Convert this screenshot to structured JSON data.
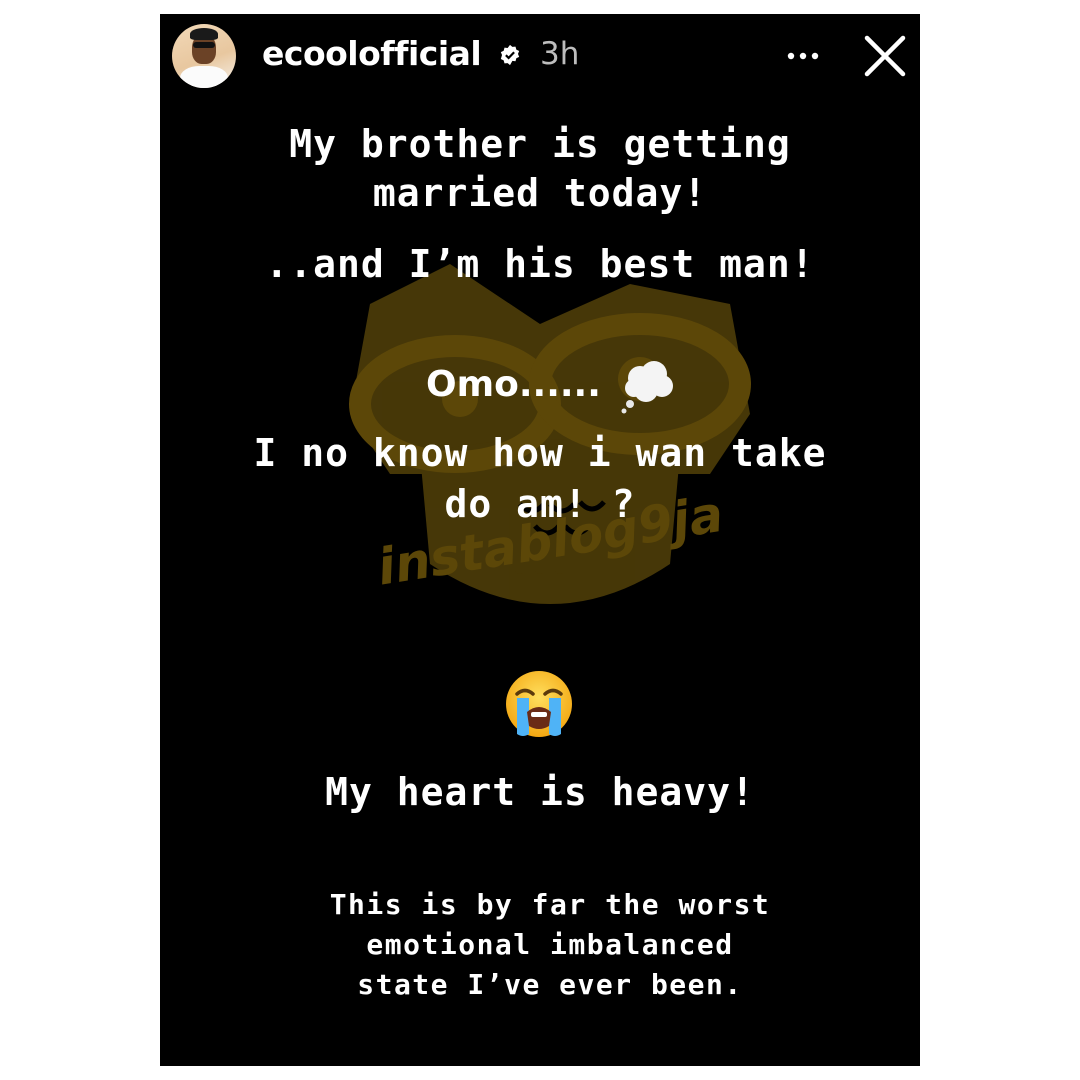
{
  "header": {
    "username": "ecoolofficial",
    "time": "3h"
  },
  "watermark": {
    "text": "instablog9ja"
  },
  "story": {
    "line1": "My brother is getting",
    "line2": "married today!",
    "line3": "..and I’m his best man!",
    "omo": "Omo......",
    "line5": "I no know how i wan take",
    "line6": "do am! ?",
    "line7": "My heart is heavy!",
    "line8": "This is by far the worst",
    "line9": "emotional imbalanced",
    "line10": "state I’ve ever been."
  },
  "icons": {
    "verified": "verified-badge-icon",
    "more": "more-options-icon",
    "close": "close-icon",
    "thought": "thought-balloon-emoji",
    "cry": "loudly-crying-face-emoji"
  },
  "colors": {
    "background": "#000000",
    "text": "#ffffff",
    "watermark": "#5c4708"
  }
}
